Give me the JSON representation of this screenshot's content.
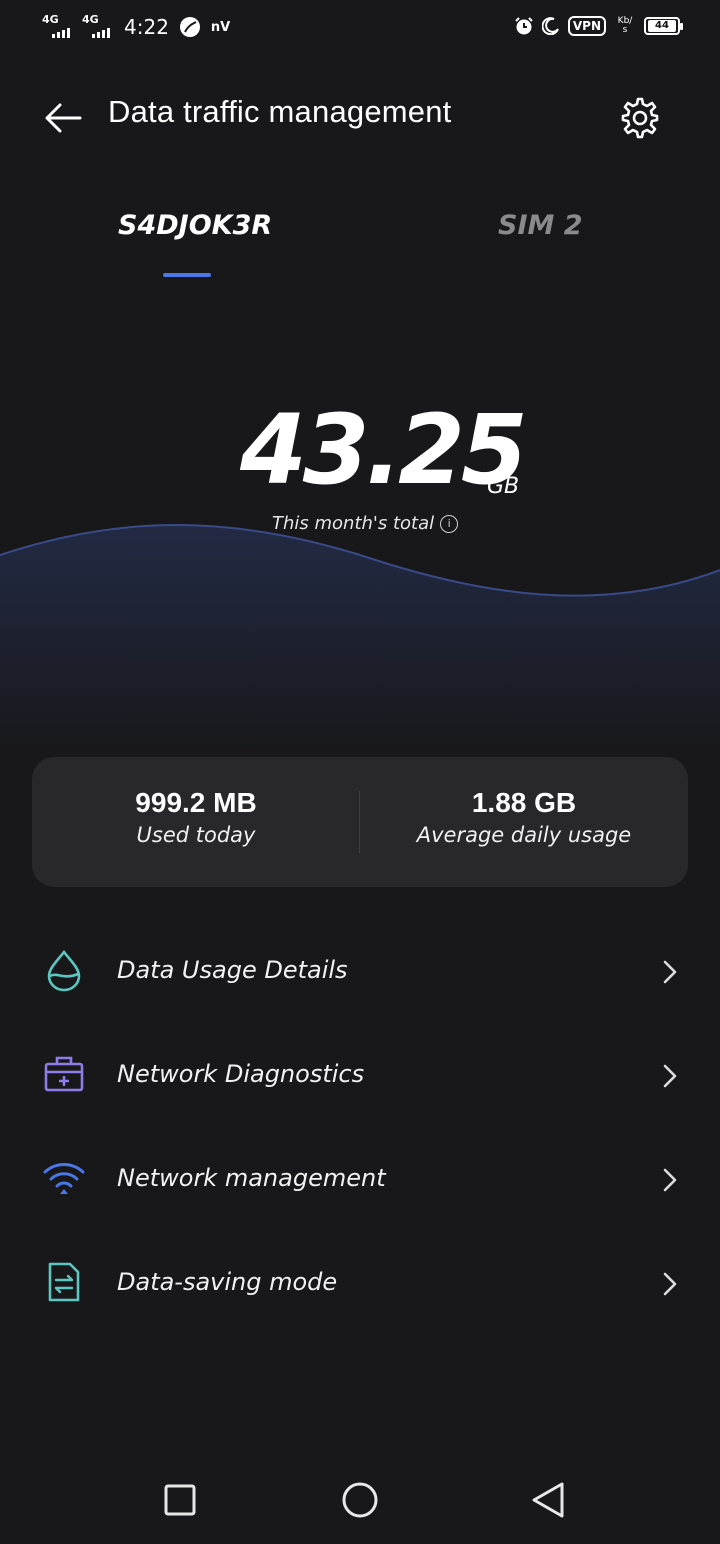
{
  "status_bar": {
    "sim1_network": "4G",
    "sim2_network": "4G",
    "time": "4:22",
    "carrier_tag": "nV",
    "vpn": "VPN",
    "speed_top": "Kb/",
    "speed_bottom": "s",
    "battery": "44"
  },
  "header": {
    "title": "Data traffic management",
    "back_icon": "arrow-left-icon",
    "settings_icon": "gear-icon"
  },
  "tabs": [
    {
      "label": "S4DJOK3R",
      "selected": true
    },
    {
      "label": "SIM 2",
      "selected": false
    }
  ],
  "accent_color": "#4a78e8",
  "usage": {
    "total_value": "43.25",
    "total_unit": "GB",
    "total_label": "This month's total",
    "info_icon": "i"
  },
  "stats": {
    "used_today_value": "999.2 MB",
    "used_today_label": "Used today",
    "avg_daily_value": "1.88 GB",
    "avg_daily_label": "Average daily usage"
  },
  "menu": [
    {
      "label": "Data Usage Details",
      "icon": "water-drop-icon",
      "color": "#5cc6c0"
    },
    {
      "label": "Network Diagnostics",
      "icon": "toolbox-icon",
      "color": "#8d7de8"
    },
    {
      "label": "Network management",
      "icon": "wifi-icon",
      "color": "#4a78e8"
    },
    {
      "label": "Data-saving mode",
      "icon": "document-transfer-icon",
      "color": "#5cc6c0"
    }
  ],
  "navbar": {
    "recent_icon": "square-icon",
    "home_icon": "circle-icon",
    "back_icon": "triangle-back-icon"
  }
}
